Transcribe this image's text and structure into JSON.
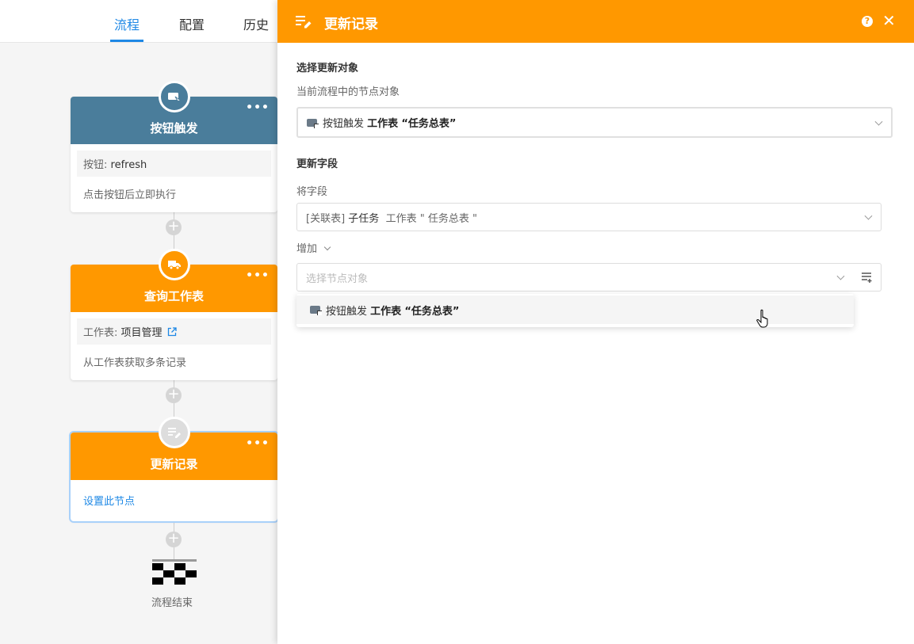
{
  "tabs": [
    {
      "label": "流程",
      "active": true
    },
    {
      "label": "配置",
      "active": false
    },
    {
      "label": "历史",
      "active": false
    }
  ],
  "nodes": [
    {
      "title": "按钮触发",
      "color": "#4a7d9b",
      "icon": "button-trigger-icon",
      "detail_label": "按钮:",
      "detail_value": "refresh",
      "description": "点击按钮后立即执行"
    },
    {
      "title": "查询工作表",
      "color": "#ff9800",
      "icon": "truck-icon",
      "detail_label": "工作表:",
      "detail_value": "项目管理",
      "description": "从工作表获取多条记录"
    },
    {
      "title": "更新记录",
      "color": "#ff9800",
      "icon": "edit-list-icon",
      "description": "设置此节点"
    }
  ],
  "end_label": "流程结束",
  "panel": {
    "title": "更新记录",
    "help": "?",
    "close": "✕",
    "section1_title": "选择更新对象",
    "section1_sub": "当前流程中的节点对象",
    "object_select": {
      "node": "按钮触发",
      "sheet_label": "工作表",
      "sheet_name": "“任务总表”"
    },
    "section2_title": "更新字段",
    "field_label": "将字段",
    "field_select": {
      "prefix": "[关联表]",
      "name": "子任务",
      "suffix": "工作表 \" 任务总表 \""
    },
    "action_label": "增加",
    "node_select_placeholder": "选择节点对象",
    "dropdown_option": {
      "node": "按钮触发",
      "sheet_label": "工作表",
      "sheet_name": "“任务总表”"
    }
  }
}
